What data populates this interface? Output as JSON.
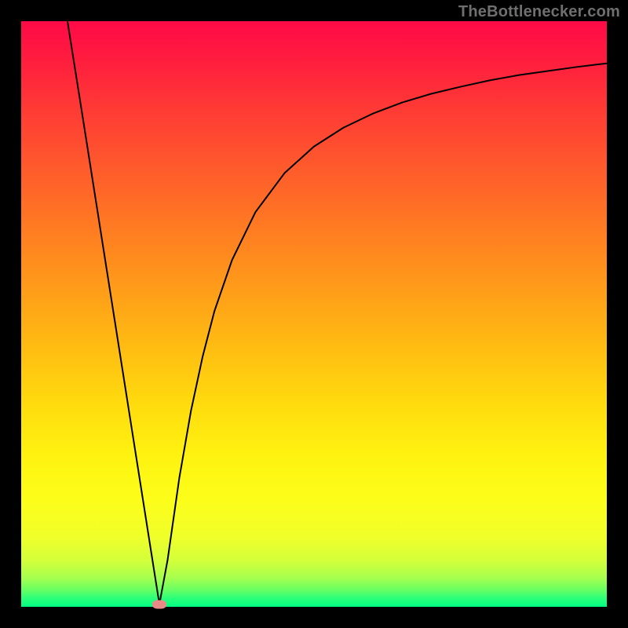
{
  "watermark": "TheBottlenecker.com",
  "chart_data": {
    "type": "line",
    "title": "",
    "xlabel": "",
    "ylabel": "",
    "xlim": [
      0,
      100
    ],
    "ylim": [
      0,
      100
    ],
    "legend": false,
    "grid": false,
    "background_gradient": {
      "direction": "vertical",
      "stops": [
        {
          "pos": 0.0,
          "color": "#ff0a47"
        },
        {
          "pos": 0.5,
          "color": "#ffae15"
        },
        {
          "pos": 0.78,
          "color": "#fff210"
        },
        {
          "pos": 0.96,
          "color": "#6cff62"
        },
        {
          "pos": 1.0,
          "color": "#00ff84"
        }
      ]
    },
    "series": [
      {
        "name": "bottleneck-curve",
        "color": "#000000",
        "stroke_width": 2,
        "x": [
          7.9,
          10,
          12,
          14,
          16,
          18,
          20,
          22,
          23.6,
          25,
          27,
          29,
          31,
          33,
          36,
          40,
          45,
          50,
          55,
          60,
          65,
          70,
          75,
          80,
          85,
          90,
          95,
          100
        ],
        "y": [
          100,
          86.8,
          74.1,
          61.4,
          48.7,
          36.0,
          23.3,
          10.6,
          0.45,
          8.0,
          22.0,
          33.5,
          42.8,
          50.5,
          59.2,
          67.4,
          74.1,
          78.6,
          81.8,
          84.2,
          86.1,
          87.6,
          88.8,
          89.9,
          90.8,
          91.5,
          92.2,
          92.8
        ]
      }
    ],
    "marker": {
      "name": "optimal-point",
      "x": 23.6,
      "y": 0.45,
      "color": "#ea8a86"
    }
  }
}
